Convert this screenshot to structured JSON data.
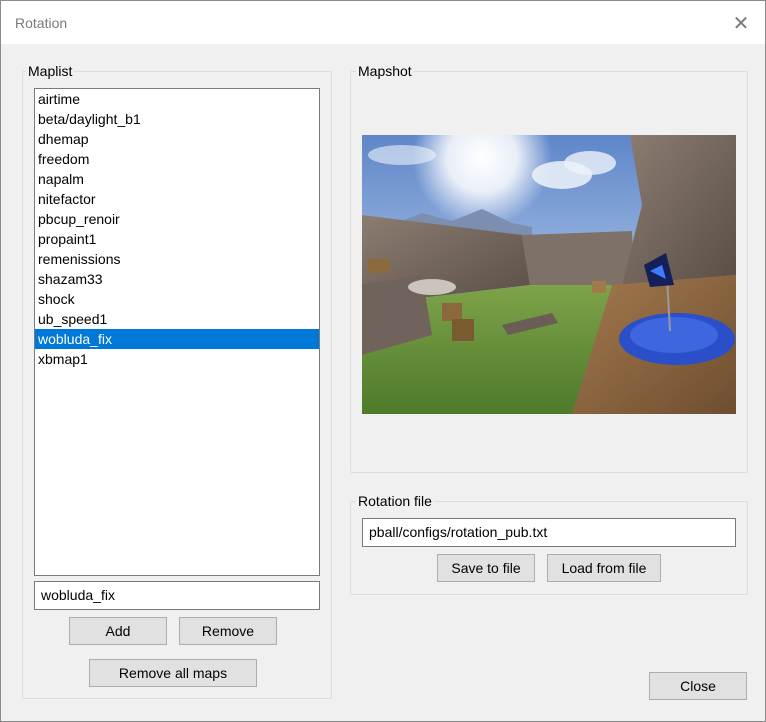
{
  "window": {
    "title": "Rotation",
    "close_symbol": "✕"
  },
  "maplist": {
    "label": "Maplist",
    "items": [
      "airtime",
      "beta/daylight_b1",
      "dhemap",
      "freedom",
      "napalm",
      "nitefactor",
      "pbcup_renoir",
      "propaint1",
      "remenissions",
      "shazam33",
      "shock",
      "ub_speed1",
      "wobluda_fix",
      "xbmap1"
    ],
    "selected": "wobluda_fix",
    "input_value": "wobluda_fix",
    "add_label": "Add",
    "remove_label": "Remove",
    "remove_all_label": "Remove all maps"
  },
  "mapshot": {
    "label": "Mapshot",
    "image": "map-preview"
  },
  "rotation_file": {
    "label": "Rotation file",
    "path": "pball/configs/rotation_pub.txt",
    "save_label": "Save to file",
    "load_label": "Load from file"
  },
  "footer": {
    "close_label": "Close"
  },
  "colors": {
    "selection": "#0078d7",
    "window_bg": "#f0f0f0",
    "button_bg": "#e1e1e1"
  }
}
